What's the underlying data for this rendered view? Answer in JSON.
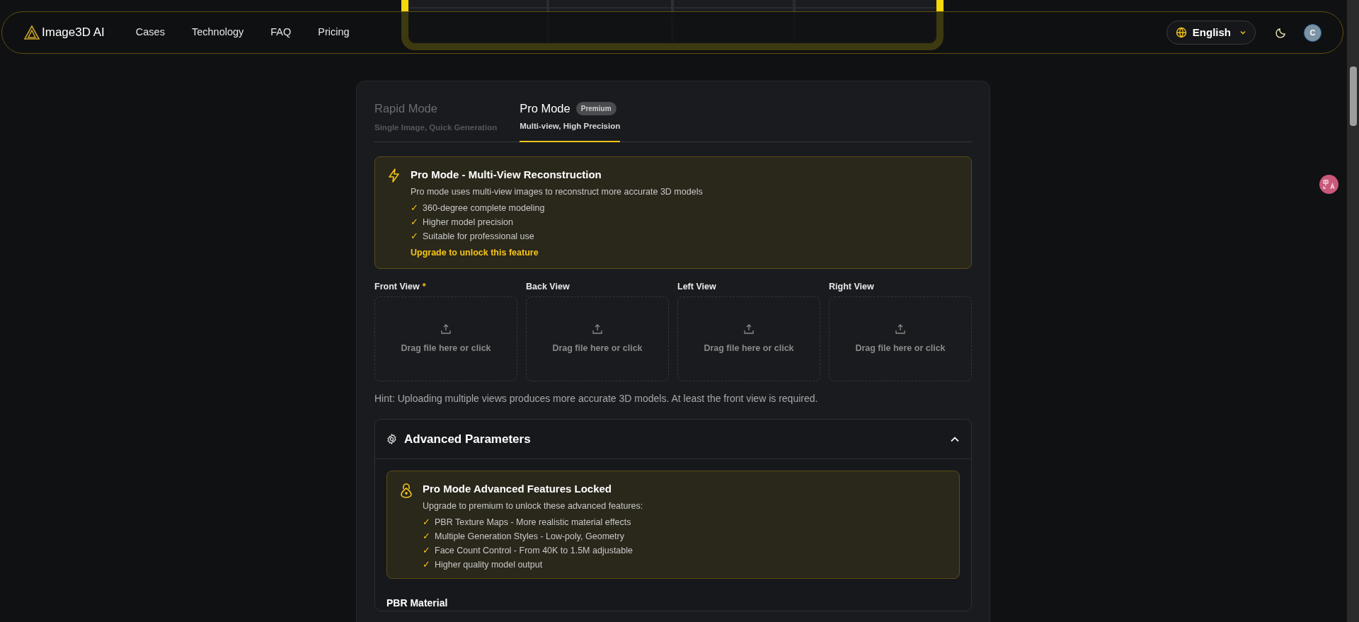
{
  "header": {
    "logo": "Image3D AI",
    "nav": [
      {
        "label": "Cases"
      },
      {
        "label": "Technology"
      },
      {
        "label": "FAQ"
      },
      {
        "label": "Pricing"
      }
    ],
    "language": "English",
    "avatar": "C"
  },
  "tabs": [
    {
      "title": "Rapid Mode",
      "subtitle": "Single Image, Quick Generation",
      "selected": false
    },
    {
      "title": "Pro Mode",
      "badge": "Premium",
      "subtitle": "Multi-view, High Precision",
      "selected": true
    }
  ],
  "pro_notice": {
    "title": "Pro Mode - Multi-View Reconstruction",
    "description": "Pro mode uses multi-view images to reconstruct more accurate 3D models",
    "features": [
      "360-degree complete modeling",
      "Higher model precision",
      "Suitable for professional use"
    ],
    "check": "✓",
    "link": "Upgrade to unlock this feature"
  },
  "views": [
    {
      "label": "Front View",
      "required": true,
      "prompt": "Drag file here or click"
    },
    {
      "label": "Back View",
      "required": false,
      "prompt": "Drag file here or click"
    },
    {
      "label": "Left View",
      "required": false,
      "prompt": "Drag file here or click"
    },
    {
      "label": "Right View",
      "required": false,
      "prompt": "Drag file here or click"
    }
  ],
  "required_mark": "*",
  "hint": "Hint: Uploading multiple views produces more accurate 3D models. At least the front view is required.",
  "advanced": {
    "title": "Advanced Parameters",
    "expanded": true,
    "locked": {
      "title": "Pro Mode Advanced Features Locked",
      "description": "Upgrade to premium to unlock these advanced features:",
      "features": [
        "PBR Texture Maps - More realistic material effects",
        "Multiple Generation Styles - Low-poly, Geometry",
        "Face Count Control - From 40K to 1.5M adjustable",
        "Higher quality model output"
      ]
    },
    "section": "PBR Material"
  }
}
